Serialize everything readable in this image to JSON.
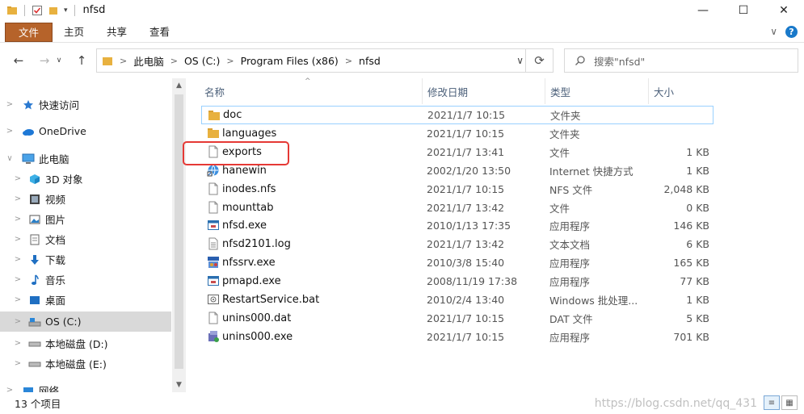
{
  "window": {
    "title": "nfsd",
    "minimize": "—",
    "maximize": "☐",
    "close": "✕"
  },
  "ribbon": {
    "tabs": [
      "文件",
      "主页",
      "共享",
      "查看"
    ],
    "expand_glyph": "∨"
  },
  "address": {
    "crumbs": [
      "此电脑",
      "OS (C:)",
      "Program Files (x86)",
      "nfsd"
    ],
    "search_placeholder": "搜索\"nfsd\""
  },
  "navpane": {
    "items": [
      {
        "label": "快速访问",
        "icon": "star-icon",
        "level": 0
      },
      {
        "label": "OneDrive",
        "icon": "cloud-icon",
        "level": 0
      },
      {
        "label": "此电脑",
        "icon": "computer-icon",
        "level": 0,
        "expanded": true
      },
      {
        "label": "3D 对象",
        "icon": "cube-icon",
        "level": 1
      },
      {
        "label": "视频",
        "icon": "video-icon",
        "level": 1
      },
      {
        "label": "图片",
        "icon": "picture-icon",
        "level": 1
      },
      {
        "label": "文档",
        "icon": "document-icon",
        "level": 1
      },
      {
        "label": "下载",
        "icon": "download-icon",
        "level": 1
      },
      {
        "label": "音乐",
        "icon": "music-icon",
        "level": 1
      },
      {
        "label": "桌面",
        "icon": "desktop-icon",
        "level": 1
      },
      {
        "label": "OS (C:)",
        "icon": "drive-c-icon",
        "level": 1,
        "selected": true
      },
      {
        "label": "本地磁盘 (D:)",
        "icon": "drive-icon",
        "level": 1
      },
      {
        "label": "本地磁盘 (E:)",
        "icon": "drive-icon",
        "level": 1
      },
      {
        "label": "网络",
        "icon": "network-icon",
        "level": 0
      }
    ]
  },
  "columns": {
    "name": "名称",
    "date": "修改日期",
    "type": "类型",
    "size": "大小"
  },
  "files": [
    {
      "name": "doc",
      "date": "2021/1/7 10:15",
      "type": "文件夹",
      "size": "",
      "icon": "folder-icon"
    },
    {
      "name": "languages",
      "date": "2021/1/7 10:15",
      "type": "文件夹",
      "size": "",
      "icon": "folder-icon"
    },
    {
      "name": "exports",
      "date": "2021/1/7 13:41",
      "type": "文件",
      "size": "1 KB",
      "icon": "file-icon"
    },
    {
      "name": "hanewin",
      "date": "2002/1/20 13:50",
      "type": "Internet 快捷方式",
      "size": "1 KB",
      "icon": "internet-shortcut-icon"
    },
    {
      "name": "inodes.nfs",
      "date": "2021/1/7 10:15",
      "type": "NFS 文件",
      "size": "2,048 KB",
      "icon": "file-icon"
    },
    {
      "name": "mounttab",
      "date": "2021/1/7 13:42",
      "type": "文件",
      "size": "0 KB",
      "icon": "file-icon"
    },
    {
      "name": "nfsd.exe",
      "date": "2010/1/13 17:35",
      "type": "应用程序",
      "size": "146 KB",
      "icon": "app-icon"
    },
    {
      "name": "nfsd2101.log",
      "date": "2021/1/7 13:42",
      "type": "文本文档",
      "size": "6 KB",
      "icon": "text-file-icon"
    },
    {
      "name": "nfssrv.exe",
      "date": "2010/3/8 15:40",
      "type": "应用程序",
      "size": "165 KB",
      "icon": "nfssrv-app-icon"
    },
    {
      "name": "pmapd.exe",
      "date": "2008/11/19 17:38",
      "type": "应用程序",
      "size": "77 KB",
      "icon": "app-icon"
    },
    {
      "name": "RestartService.bat",
      "date": "2010/2/4 13:40",
      "type": "Windows 批处理...",
      "size": "1 KB",
      "icon": "batch-file-icon"
    },
    {
      "name": "unins000.dat",
      "date": "2021/1/7 10:15",
      "type": "DAT 文件",
      "size": "5 KB",
      "icon": "file-icon"
    },
    {
      "name": "unins000.exe",
      "date": "2021/1/7 10:15",
      "type": "应用程序",
      "size": "701 KB",
      "icon": "uninstaller-icon"
    }
  ],
  "status": {
    "item_count": "13 个项目",
    "watermark": "https://blog.csdn.net/qq_431"
  },
  "colors": {
    "file_tab": "#b6632a",
    "folder": "#e8b13f",
    "highlight_box": "#e53935",
    "selected_nav": "#d9d9d9"
  }
}
